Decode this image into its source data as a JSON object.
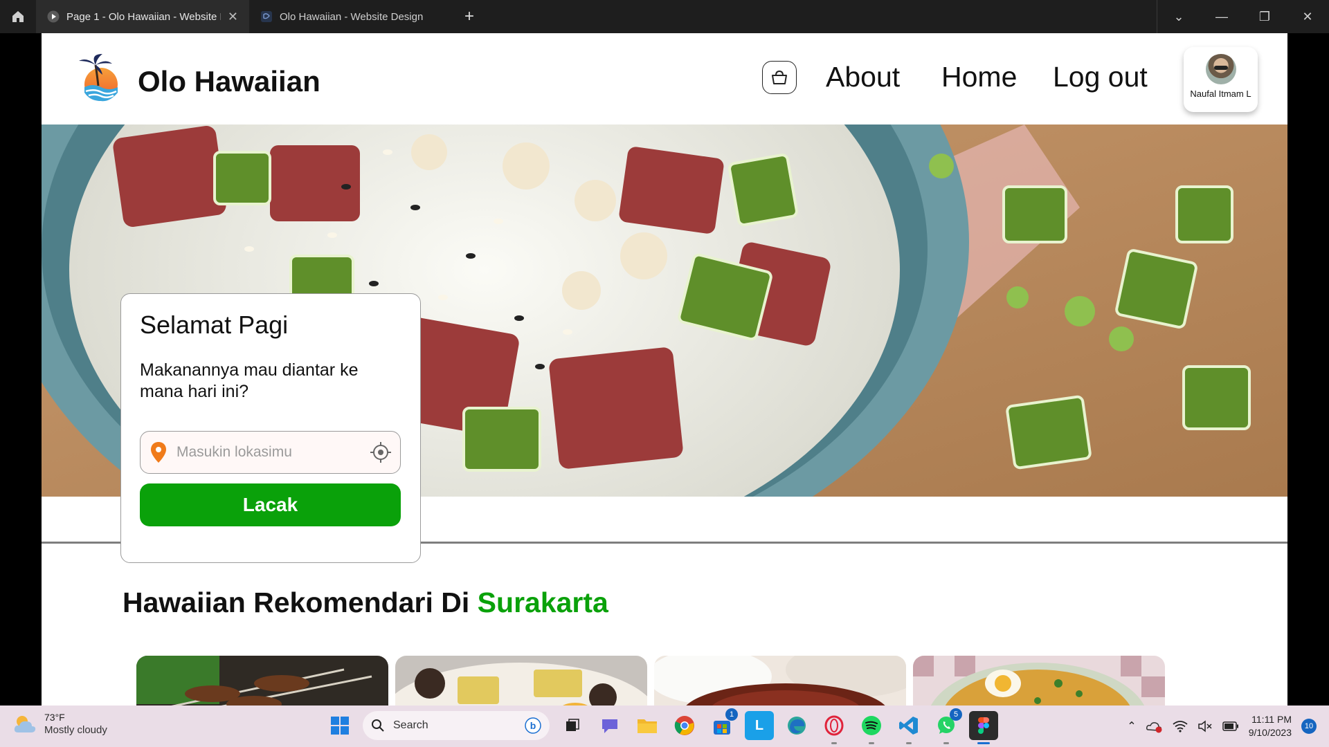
{
  "window": {
    "tabs": [
      {
        "title": "Page 1 - Olo Hawaiian - Website De",
        "active": true
      },
      {
        "title": "Olo Hawaiian - Website Design",
        "active": false
      }
    ],
    "new_tab_label": "+"
  },
  "header": {
    "brand": "Olo Hawaiian",
    "nav": [
      "About",
      "Home",
      "Log out"
    ],
    "profile_name": "Naufal Itmam L"
  },
  "card": {
    "title": "Selamat Pagi",
    "subtitle": "Makanannya mau diantar ke mana hari ini?",
    "location_placeholder": "Masukin lokasimu",
    "button_label": "Lacak"
  },
  "section": {
    "title": "Hawaiian Rekomendari Di ",
    "city": "Surakarta"
  },
  "colors": {
    "accent_green": "#0aa10a",
    "pin_orange": "#f07b1a"
  },
  "taskbar": {
    "weather_temp": "73°F",
    "weather_condition": "Mostly cloudy",
    "search_placeholder": "Search",
    "store_badge": "1",
    "whatsapp_badge": "5",
    "time": "11:11 PM",
    "date": "9/10/2023",
    "notification_count": "10"
  }
}
